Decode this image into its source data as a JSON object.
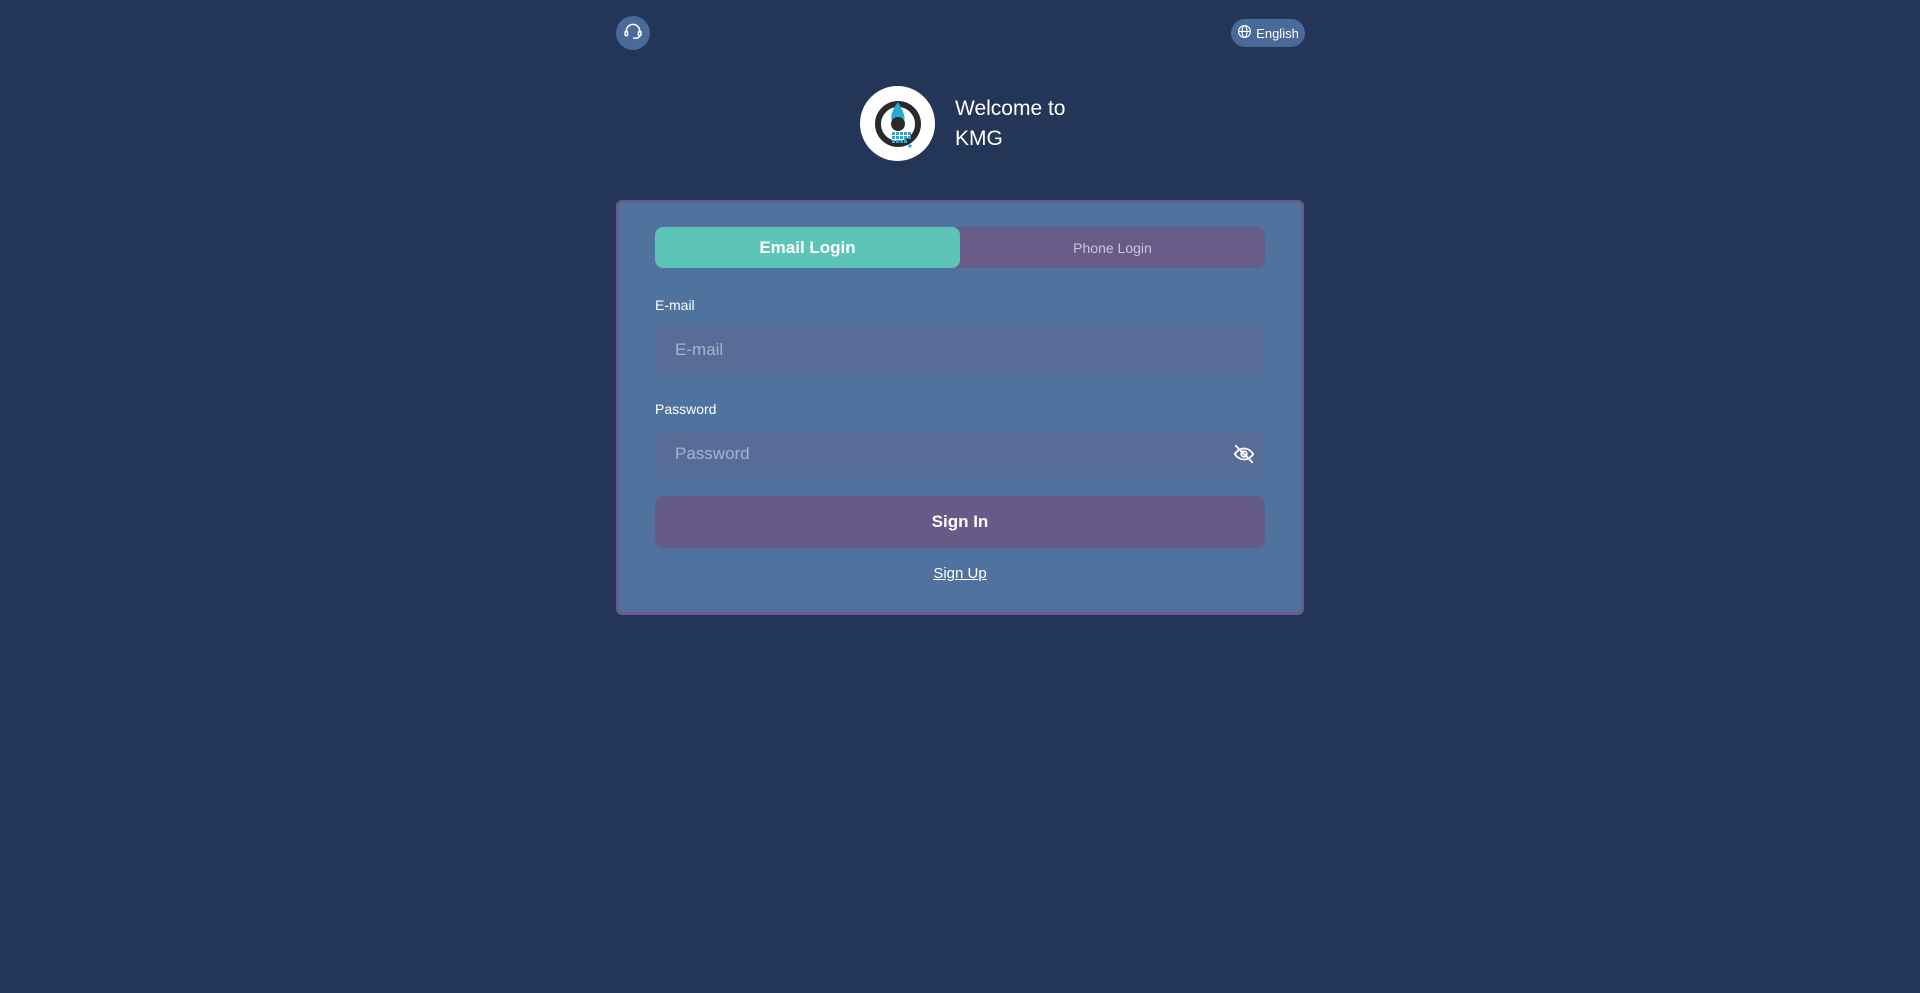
{
  "header": {
    "support_icon": "headset-icon",
    "language_icon": "globe-icon",
    "language_label": "English"
  },
  "brand": {
    "logo_icon": "kmg-logo",
    "welcome_line1": "Welcome to",
    "welcome_line2": "KMG"
  },
  "login": {
    "tabs": [
      {
        "label": "Email Login",
        "active": true
      },
      {
        "label": "Phone Login",
        "active": false
      }
    ],
    "email_label": "E-mail",
    "email_value": "",
    "email_placeholder": "E-mail",
    "password_label": "Password",
    "password_value": "",
    "password_placeholder": "Password",
    "password_toggle_icon": "eye-off-icon",
    "signin_label": "Sign In",
    "signup_label": "Sign Up"
  },
  "colors": {
    "background": "#233657",
    "card": "#4f729e",
    "card_border": "#6a5a8e",
    "tab_active": "#5cc5b7",
    "tab_inactive": "#675b88",
    "input_bg": "#576d98",
    "signin_bg": "#665a86",
    "pill_bg": "#4a6a9a"
  }
}
